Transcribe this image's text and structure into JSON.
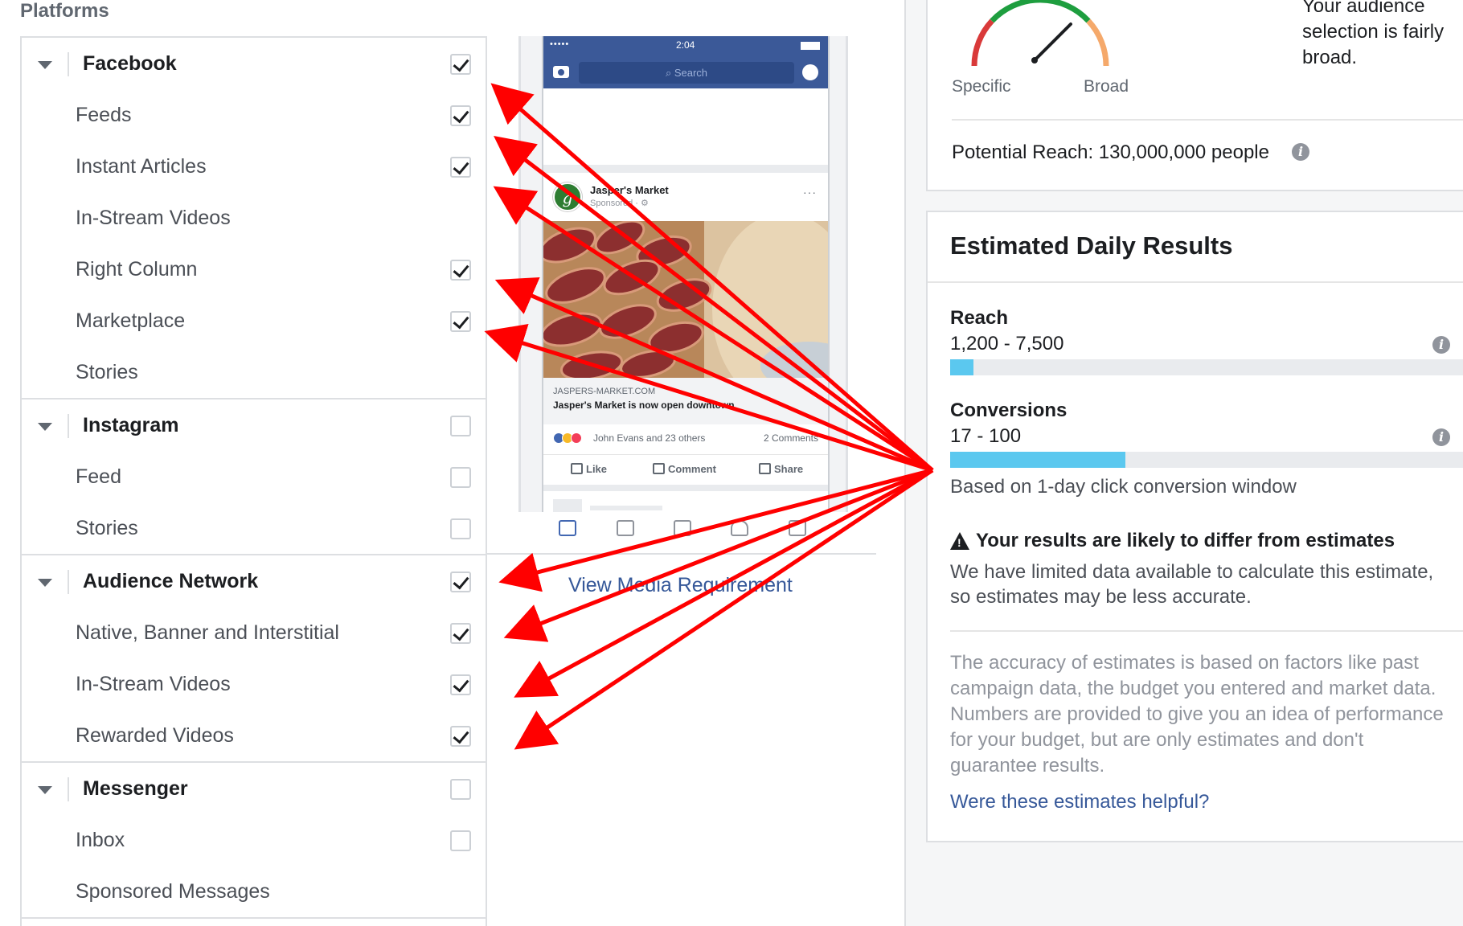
{
  "platforms": {
    "title": "Platforms",
    "groups": [
      {
        "label": "Facebook",
        "checked": true,
        "items": [
          {
            "label": "Feeds",
            "checked": true
          },
          {
            "label": "Instant Articles",
            "checked": true
          },
          {
            "label": "In-Stream Videos",
            "checked": null
          },
          {
            "label": "Right Column",
            "checked": true
          },
          {
            "label": "Marketplace",
            "checked": true
          },
          {
            "label": "Stories",
            "checked": null
          }
        ]
      },
      {
        "label": "Instagram",
        "checked": false,
        "items": [
          {
            "label": "Feed",
            "checked": false
          },
          {
            "label": "Stories",
            "checked": false
          }
        ]
      },
      {
        "label": "Audience Network",
        "checked": true,
        "items": [
          {
            "label": "Native, Banner and Interstitial",
            "checked": true
          },
          {
            "label": "In-Stream Videos",
            "checked": true
          },
          {
            "label": "Rewarded Videos",
            "checked": true
          }
        ]
      },
      {
        "label": "Messenger",
        "checked": false,
        "items": [
          {
            "label": "Inbox",
            "checked": false
          },
          {
            "label": "Sponsored Messages",
            "checked": null
          }
        ]
      }
    ]
  },
  "preview": {
    "status_time": "2:04",
    "signal": "•••••",
    "search_placeholder": "Search",
    "post": {
      "author": "Jasper's Market",
      "sponsored": "Sponsored · ⚙",
      "more": "···",
      "link_domain": "JASPERS-MARKET.COM",
      "link_title": "Jasper's Market is now open downtown",
      "reactions_text": "John Evans and 23 others",
      "comments_count": "2 Comments",
      "actions": {
        "like": "Like",
        "comment": "Comment",
        "share": "Share"
      }
    },
    "media_link": "View Media Requirement"
  },
  "audience": {
    "gauge_specific": "Specific",
    "gauge_broad": "Broad",
    "description": "Your audience selection is fairly broad.",
    "potential_reach": "Potential Reach: 130,000,000 people"
  },
  "estimates": {
    "title": "Estimated Daily Results",
    "reach": {
      "label": "Reach",
      "value": "1,200 - 7,500",
      "fill_fraction": 0.045
    },
    "conversions": {
      "label": "Conversions",
      "value": "17 - 100",
      "fill_fraction": 0.34
    },
    "window_note": "Based on 1-day click conversion window",
    "warning_title": "Your results are likely to differ from estimates",
    "warning_body": "We have limited data available to calculate this estimate, so estimates may be less accurate.",
    "accuracy_note": "The accuracy of estimates is based on factors like past campaign data, the budget you entered and market data. Numbers are provided to give you an idea of performance for your budget, but are only estimates and don't guarantee results.",
    "helpful_link": "Were these estimates helpful?"
  },
  "colors": {
    "accent_blue": "#4267b2",
    "fb_blue": "#3b5998",
    "bar_fill": "#5bc8ef",
    "arrow_red": "#ff0000",
    "gauge_red": "#d93a3a",
    "gauge_green": "#1e9e3f",
    "gauge_orange": "#f5a96b"
  }
}
